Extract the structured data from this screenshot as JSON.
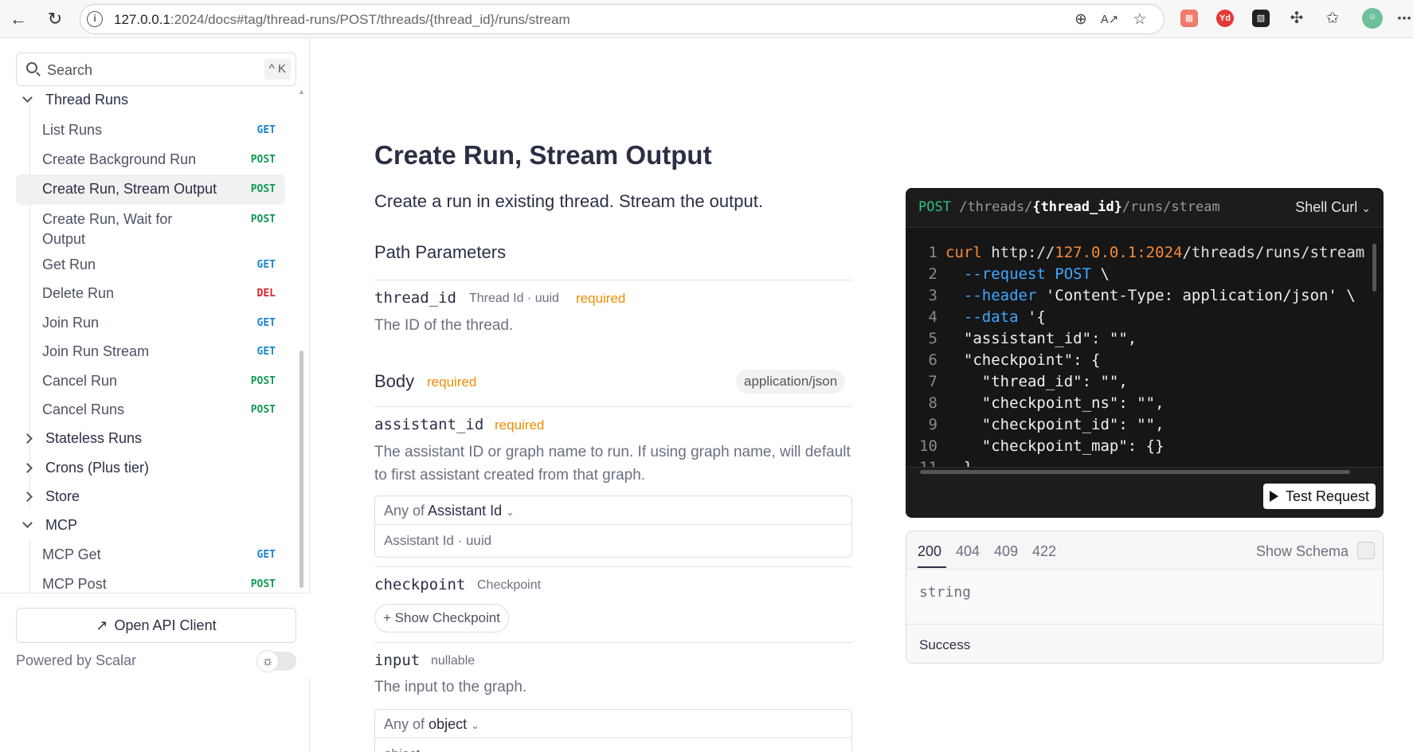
{
  "browser": {
    "url_host": "127.0.0.1",
    "url_rest": ":2024/docs#tag/thread-runs/POST/threads/{thread_id}/runs/stream",
    "ext_badge": "Yd"
  },
  "sidebar": {
    "search_placeholder": "Search",
    "search_shortcut": "^ K",
    "groups": {
      "thread_runs": "Thread Runs",
      "stateless_runs": "Stateless Runs",
      "crons": "Crons (Plus tier)",
      "store": "Store",
      "mcp": "MCP"
    },
    "items": [
      {
        "label": "List Runs",
        "method": "GET"
      },
      {
        "label": "Create Background Run",
        "method": "POST"
      },
      {
        "label": "Create Run, Stream Output",
        "method": "POST"
      },
      {
        "label": "Create Run, Wait for Output",
        "method": "POST"
      },
      {
        "label": "Get Run",
        "method": "GET"
      },
      {
        "label": "Delete Run",
        "method": "DEL"
      },
      {
        "label": "Join Run",
        "method": "GET"
      },
      {
        "label": "Join Run Stream",
        "method": "GET"
      },
      {
        "label": "Cancel Run",
        "method": "POST"
      },
      {
        "label": "Cancel Runs",
        "method": "POST"
      }
    ],
    "mcp_items": [
      {
        "label": "MCP Get",
        "method": "GET"
      },
      {
        "label": "MCP Post",
        "method": "POST"
      }
    ],
    "open_api_client": "Open API Client",
    "powered_by": "Powered by Scalar"
  },
  "main": {
    "title": "Create Run, Stream Output",
    "description": "Create a run in existing thread. Stream the output.",
    "path_params_heading": "Path Parameters",
    "thread_id": {
      "name": "thread_id",
      "type": "Thread Id · uuid",
      "required": "required",
      "desc": "The ID of the thread."
    },
    "body_heading": "Body",
    "body_required": "required",
    "content_type": "application/json",
    "assistant_id": {
      "name": "assistant_id",
      "required": "required",
      "desc": "The assistant ID or graph name to run. If using graph name, will default to first assistant created from that graph.",
      "anyof_prefix": "Any of",
      "anyof_type": "Assistant Id",
      "anyof_body": "Assistant Id · uuid"
    },
    "checkpoint": {
      "name": "checkpoint",
      "type": "Checkpoint",
      "button": "Show Checkpoint"
    },
    "input": {
      "name": "input",
      "type": "nullable",
      "desc": "The input to the graph.",
      "anyof_prefix": "Any of",
      "anyof_type": "object",
      "anyof_body": "object"
    }
  },
  "code": {
    "method": "POST",
    "path_prefix": "/threads/",
    "path_param": "{thread_id}",
    "path_suffix": "/runs/stream",
    "language": "Shell Curl",
    "test_button": "Test Request"
  },
  "response": {
    "codes": [
      "200",
      "404",
      "409",
      "422"
    ],
    "show_schema": "Show Schema",
    "body": "string",
    "footer": "Success"
  }
}
